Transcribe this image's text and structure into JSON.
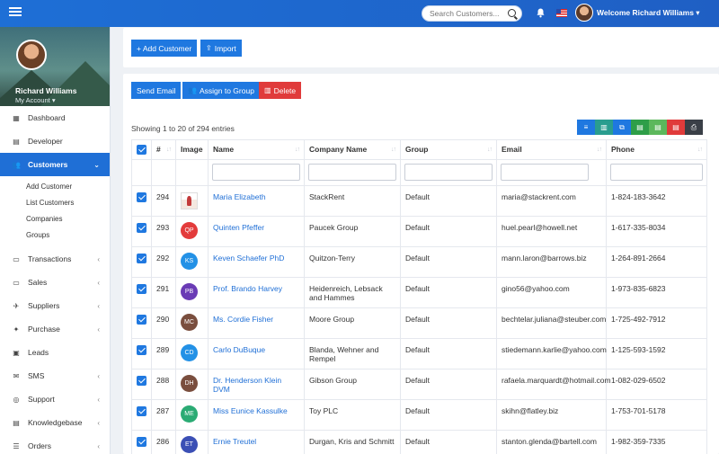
{
  "topbar": {
    "search_placeholder": "Search Customers...",
    "welcome": "Welcome Richard Williams ▾"
  },
  "sidebar": {
    "profile_name": "Richard Williams",
    "profile_sub": "My Account",
    "items": [
      {
        "label": "Dashboard",
        "icon": "▦",
        "chevron": ""
      },
      {
        "label": "Developer",
        "icon": "▤",
        "chevron": ""
      },
      {
        "label": "Customers",
        "icon": "👥",
        "chevron": "⌄"
      },
      {
        "label": "Transactions",
        "icon": "▭",
        "chevron": "‹"
      },
      {
        "label": "Sales",
        "icon": "▭",
        "chevron": "‹"
      },
      {
        "label": "Suppliers",
        "icon": "✈",
        "chevron": "‹"
      },
      {
        "label": "Purchase",
        "icon": "✦",
        "chevron": "‹"
      },
      {
        "label": "Leads",
        "icon": "▣",
        "chevron": ""
      },
      {
        "label": "SMS",
        "icon": "✉",
        "chevron": "‹"
      },
      {
        "label": "Support",
        "icon": "◎",
        "chevron": "‹"
      },
      {
        "label": "Knowledgebase",
        "icon": "▤",
        "chevron": "‹"
      },
      {
        "label": "Orders",
        "icon": "☰",
        "chevron": "‹"
      }
    ],
    "customers_sub": [
      "Add Customer",
      "List Customers",
      "Companies",
      "Groups"
    ]
  },
  "actions": {
    "add_customer": "+ Add Customer",
    "import": "Import",
    "send_email": "Send Email",
    "assign_group": "Assign to Group",
    "delete": "Delete"
  },
  "table": {
    "entries": "Showing 1 to 20 of 294 entries",
    "headers": {
      "id": "#",
      "image": "Image",
      "name": "Name",
      "company": "Company Name",
      "group": "Group",
      "email": "Email",
      "phone": "Phone"
    },
    "rows": [
      {
        "id": "294",
        "initials": "",
        "avatar_color": "",
        "name": "Maria Elizabeth",
        "company": "StackRent",
        "group": "Default",
        "email": "maria@stackrent.com",
        "phone": "1-824-183-3642"
      },
      {
        "id": "293",
        "initials": "QP",
        "avatar_color": "#e33b3b",
        "name": "Quinten Pfeffer",
        "company": "Paucek Group",
        "group": "Default",
        "email": "huel.pearl@howell.net",
        "phone": "1-617-335-8034"
      },
      {
        "id": "292",
        "initials": "KS",
        "avatar_color": "#2391e6",
        "name": "Keven Schaefer PhD",
        "company": "Quitzon-Terry",
        "group": "Default",
        "email": "mann.laron@barrows.biz",
        "phone": "1-264-891-2664"
      },
      {
        "id": "291",
        "initials": "PB",
        "avatar_color": "#6a3bb5",
        "name": "Prof. Brando Harvey",
        "company": "Heidenreich, Lebsack and Hammes",
        "group": "Default",
        "email": "gino56@yahoo.com",
        "phone": "1-973-835-6823"
      },
      {
        "id": "290",
        "initials": "MC",
        "avatar_color": "#7a4e3e",
        "name": "Ms. Cordie Fisher",
        "company": "Moore Group",
        "group": "Default",
        "email": "bechtelar.juliana@steuber.com",
        "phone": "1-725-492-7912"
      },
      {
        "id": "289",
        "initials": "CD",
        "avatar_color": "#2391e6",
        "name": "Carlo DuBuque",
        "company": "Blanda, Wehner and Rempel",
        "group": "Default",
        "email": "stiedemann.karlie@yahoo.com",
        "phone": "1-125-593-1592"
      },
      {
        "id": "288",
        "initials": "DH",
        "avatar_color": "#7a4e3e",
        "name": "Dr. Henderson Klein DVM",
        "company": "Gibson Group",
        "group": "Default",
        "email": "rafaela.marquardt@hotmail.com",
        "phone": "1-082-029-6502"
      },
      {
        "id": "287",
        "initials": "ME",
        "avatar_color": "#2bab74",
        "name": "Miss Eunice Kassulke",
        "company": "Toy PLC",
        "group": "Default",
        "email": "skihn@flatley.biz",
        "phone": "1-753-701-5178"
      },
      {
        "id": "286",
        "initials": "ET",
        "avatar_color": "#3b4fb5",
        "name": "Ernie Treutel",
        "company": "Durgan, Kris and Schmitt",
        "group": "Default",
        "email": "stanton.glenda@bartell.com",
        "phone": "1-982-359-7335"
      }
    ]
  },
  "export_tools": [
    {
      "icon": "list-icon",
      "glyph": "≡",
      "color": "#1f78e0"
    },
    {
      "icon": "columns-icon",
      "glyph": "▥",
      "color": "#2a9d8f"
    },
    {
      "icon": "copy-icon",
      "glyph": "⧉",
      "color": "#1f78e0"
    },
    {
      "icon": "excel-icon",
      "glyph": "▤",
      "color": "#2e9e48"
    },
    {
      "icon": "csv-icon",
      "glyph": "▤",
      "color": "#5cb85c"
    },
    {
      "icon": "pdf-icon",
      "glyph": "▤",
      "color": "#e03b3b"
    },
    {
      "icon": "print-icon",
      "glyph": "⎙",
      "color": "#3a3f47"
    }
  ]
}
